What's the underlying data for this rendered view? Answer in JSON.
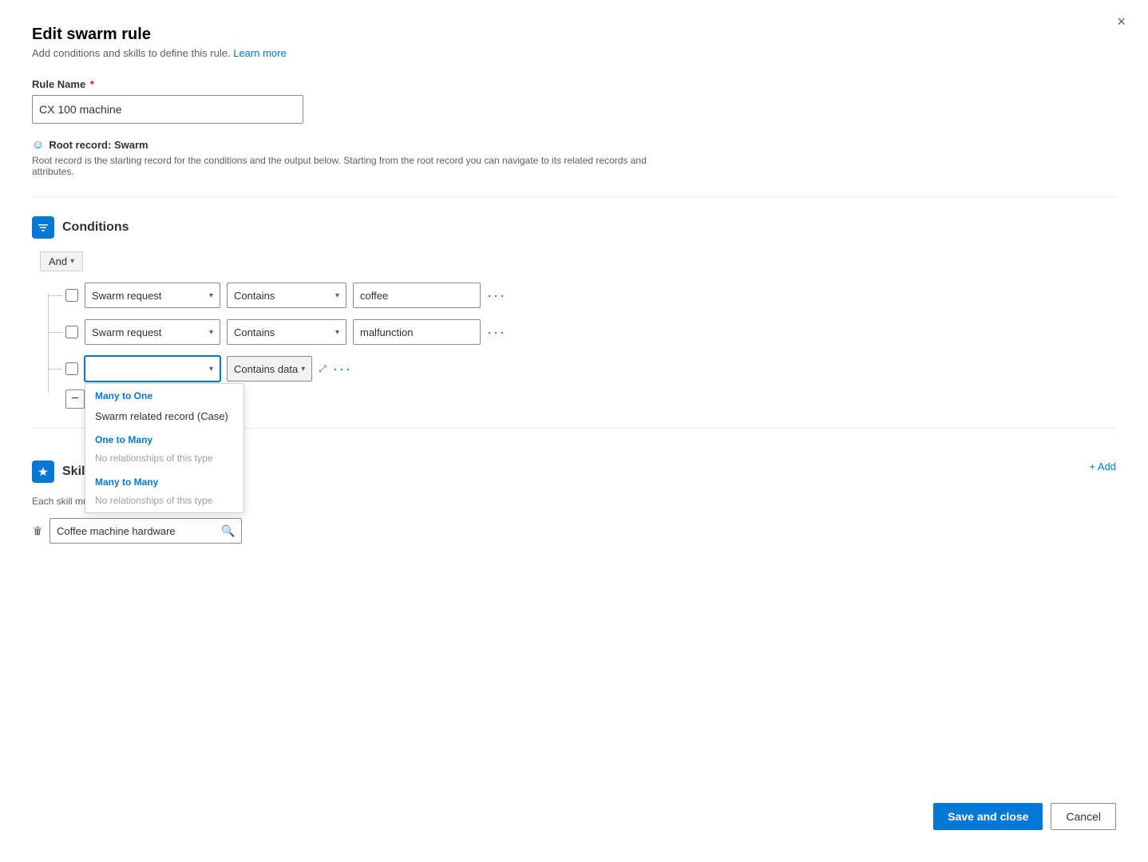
{
  "modal": {
    "title": "Edit swarm rule",
    "subtitle": "Add conditions and skills to define this rule.",
    "learn_more": "Learn more",
    "close_label": "×"
  },
  "rule_name": {
    "label": "Rule Name",
    "required": true,
    "value": "CX 100 machine"
  },
  "root_record": {
    "label": "Root record: Swarm",
    "description": "Root record is the starting record for the conditions and the output below. Starting from the root record you can navigate to its related records and attributes."
  },
  "conditions_section": {
    "title": "Conditions",
    "and_label": "And",
    "rows": [
      {
        "field": "Swarm request",
        "operator": "Contains",
        "value": "coffee"
      },
      {
        "field": "Swarm request",
        "operator": "Contains",
        "value": "malfunction"
      }
    ],
    "third_row": {
      "field_placeholder": "",
      "operator": "Contains data",
      "expand_icon": "⤢"
    },
    "dropdown": {
      "many_to_one_label": "Many to One",
      "swarm_related_record": "Swarm related record (Case)",
      "one_to_many_label": "One to Many",
      "no_one_to_many": "No relationships of this type",
      "many_to_many_label": "Many to Many",
      "no_many_to_many": "No relationships of this type"
    }
  },
  "skills_section": {
    "title": "Skills",
    "description": "Each skill must be unique.",
    "add_label": "+ Add",
    "skills": [
      {
        "value": "Coffee machine hardware"
      }
    ]
  },
  "footer": {
    "save_label": "Save and close",
    "cancel_label": "Cancel"
  }
}
